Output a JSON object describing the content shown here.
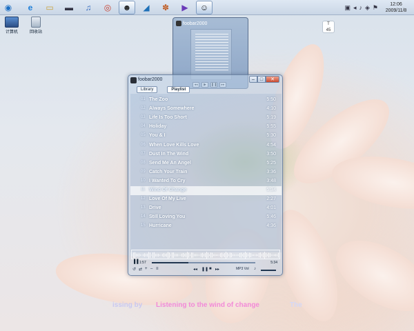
{
  "taskbar": {
    "buttons": [
      {
        "icon": "start-orb-icon",
        "glyph": "◉"
      },
      {
        "icon": "ie-icon",
        "glyph": "e"
      },
      {
        "icon": "explorer-icon",
        "glyph": "▭"
      },
      {
        "icon": "console-icon",
        "glyph": "▬"
      },
      {
        "icon": "itunes-icon",
        "glyph": "♫"
      },
      {
        "icon": "chrome-icon",
        "glyph": "◎"
      },
      {
        "icon": "qq-icon",
        "glyph": "☻"
      },
      {
        "icon": "app-icon",
        "glyph": "◢"
      },
      {
        "icon": "tool-icon",
        "glyph": "✽"
      },
      {
        "icon": "media-icon",
        "glyph": "▶"
      },
      {
        "icon": "foobar-icon",
        "glyph": "☺"
      }
    ],
    "clock": {
      "time": "12:06",
      "date": "2009/11/8"
    }
  },
  "desktop": {
    "icons": [
      {
        "label": "计算机"
      },
      {
        "label": "回收站"
      }
    ],
    "gadget_text": "T\n45"
  },
  "thumbnail": {
    "title": "foobar2000"
  },
  "player": {
    "title": "foobar2000",
    "tabs": [
      "Library",
      "Playlist"
    ],
    "tracks": [
      {
        "num": "01",
        "name": "The Zoo",
        "dur": "5:50"
      },
      {
        "num": "02",
        "name": "Always Somewhere",
        "dur": "4:10"
      },
      {
        "num": "03",
        "name": "Life Is Too Short",
        "dur": "5:19"
      },
      {
        "num": "04",
        "name": "Holiday",
        "dur": "5:55"
      },
      {
        "num": "05",
        "name": "You & I",
        "dur": "5:30"
      },
      {
        "num": "06",
        "name": "When Love Kills Love",
        "dur": "4:54"
      },
      {
        "num": "07",
        "name": "Dust In The Wind",
        "dur": "3:50"
      },
      {
        "num": "08",
        "name": "Send Me An Angel",
        "dur": "5:25"
      },
      {
        "num": "09",
        "name": "Catch Your Train",
        "dur": "3:36"
      },
      {
        "num": "10",
        "name": "I Wanted To Cry",
        "dur": "3:48"
      },
      {
        "num": "11",
        "name": "Wind Of Change",
        "dur": "5:34"
      },
      {
        "num": "12",
        "name": "Love Of My Live",
        "dur": "2:27"
      },
      {
        "num": "13",
        "name": "Drive",
        "dur": "4:01"
      },
      {
        "num": "14",
        "name": "Still Loving You",
        "dur": "5:46"
      },
      {
        "num": "15",
        "name": "Hurricane",
        "dur": "4:36"
      }
    ],
    "selected_index": 10,
    "time_elapsed": "1:57",
    "time_total": "5:34",
    "progress": 0.35,
    "status_text": "MP3 Vol"
  },
  "lyrics": {
    "left": "issing by",
    "main": "Listening to the wind of change",
    "right": "The"
  }
}
